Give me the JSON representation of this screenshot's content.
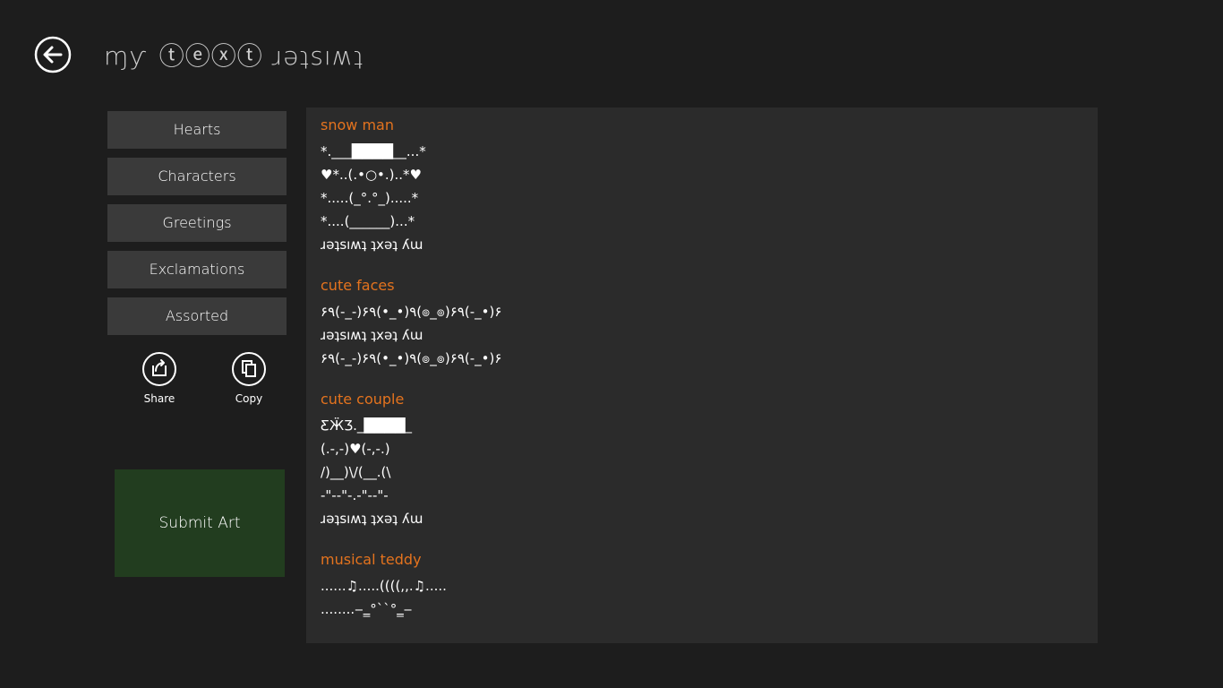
{
  "header": {
    "title": "ɱƴ ⓣⓔⓧⓣ ɹǝʇsıʍʇ"
  },
  "categories": [
    {
      "label": "Hearts"
    },
    {
      "label": "Characters"
    },
    {
      "label": "Greetings"
    },
    {
      "label": "Exclamations"
    },
    {
      "label": "Assorted"
    }
  ],
  "actions": {
    "share_label": "Share",
    "copy_label": "Copy"
  },
  "submit_label": "Submit Art",
  "sections": [
    {
      "title": "snow man",
      "lines": [
        "*.___████__...*",
        "♥*..(.•○•.)..*♥",
        "*.....(_°.°_).....*",
        "*....(______)...*",
        "ɹǝʇsıʍʇ ʇxǝʇ ʎɯ"
      ]
    },
    {
      "title": "cute faces",
      "lines": [
        "۶٩(-_-)۶٩(•_•)٩(๏_๏)۶٩(-_•)۶",
        "ɹǝʇsıʍʇ ʇxǝʇ ʎɯ",
        "۶٩(-_-)۶٩(•_•)٩(๏_๏)۶٩(-_•)۶"
      ]
    },
    {
      "title": "cute couple",
      "lines": [
        "ƸӜƷ._████_",
        "(.-,-)♥(-,-.)",
        "/)__)\\/(__.(\\",
        "-\"--\"-.-\"--\"-",
        "ɹǝʇsıʍʇ ʇxǝʇ ʎɯ"
      ]
    },
    {
      "title": "musical teddy",
      "lines": [
        "......♫.....((((,,.♫.....",
        "........‒‗°``°‗‒"
      ]
    }
  ],
  "colors": {
    "background": "#1d1d1d",
    "panel": "#2b2b2b",
    "button": "#3a3a3a",
    "accent_orange": "#e4731e",
    "submit_green": "#223d1f"
  }
}
